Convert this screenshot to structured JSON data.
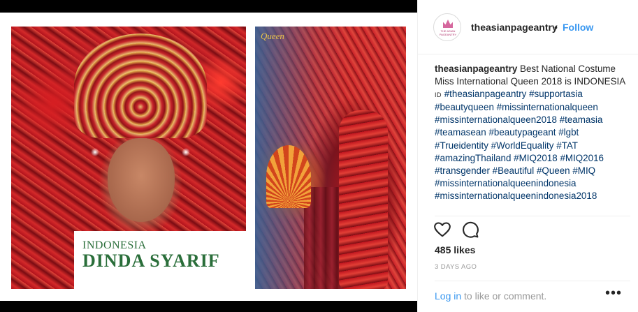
{
  "post": {
    "left_photo": {
      "country_text": "INDONESIA",
      "name_text": "DINDA SYARIF"
    },
    "right_photo": {
      "logo_text": "Queen"
    }
  },
  "header": {
    "username": "theasianpageantry",
    "separator": "•",
    "follow_label": "Follow",
    "avatar_text": "THE ASIAN PAGEANTRY"
  },
  "caption": {
    "author": "theasianpageantry",
    "text_part1": " Best National Costume Miss International Queen 2018 is INDONESIA ",
    "id_badge": "ID",
    "hashtags": [
      "#theasianpageantry",
      "#supportasia",
      "#beautyqueen",
      "#missinternationalqueen",
      "#missinternationalqueen2018",
      "#teamasia",
      "#teamasean",
      "#beautypageant",
      "#lgbt",
      "#Trueidentity",
      "#WorldEquality",
      "#TAT",
      "#amazingThailand",
      "#MIQ2018",
      "#MIQ2016",
      "#transgender",
      "#Beautiful",
      "#Queen",
      "#MIQ",
      "#missinternationalqueenindonesia",
      "#missinternationalqueenindonesia2018"
    ]
  },
  "actions": {
    "like_icon": "heart-icon",
    "comment_icon": "comment-icon"
  },
  "likes_text": "485 likes",
  "timestamp": "3 DAYS AGO",
  "footer": {
    "login_label": "Log in",
    "login_suffix": " to like or comment.",
    "more_label": "•••"
  },
  "colors": {
    "link_blue": "#3897f0",
    "hashtag_blue": "#003569",
    "text": "#262626",
    "muted": "#999999"
  }
}
